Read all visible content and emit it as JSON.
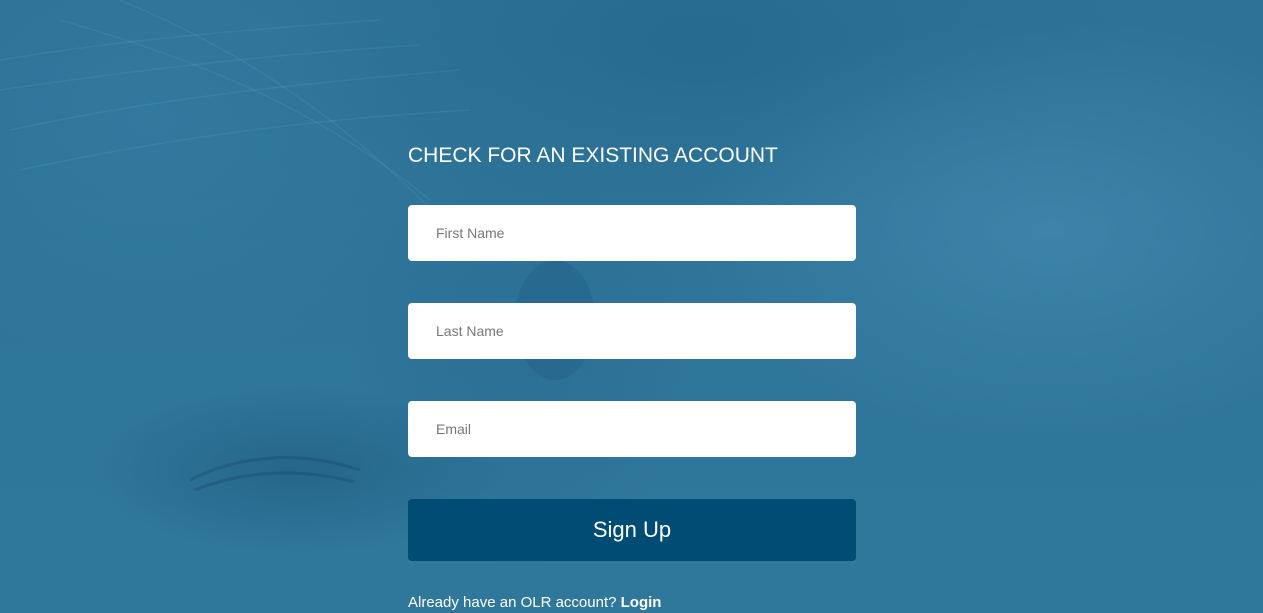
{
  "form": {
    "title": "CHECK FOR AN EXISTING ACCOUNT",
    "first_name_placeholder": "First Name",
    "last_name_placeholder": "Last Name",
    "email_placeholder": "Email",
    "submit_label": "Sign Up"
  },
  "footer": {
    "prompt": "Already have an OLR account?",
    "login_label": "Login"
  },
  "colors": {
    "background_overlay": "#2b7196",
    "button": "#004c74",
    "input_background": "#ffffff",
    "text": "#ffffff"
  }
}
